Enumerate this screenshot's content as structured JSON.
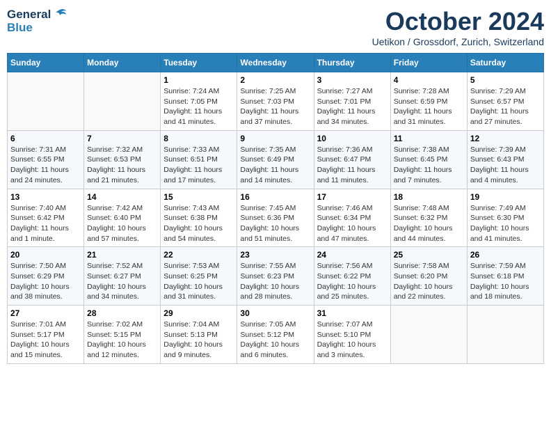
{
  "header": {
    "logo_general": "General",
    "logo_blue": "Blue",
    "month": "October 2024",
    "location": "Uetikon / Grossdorf, Zurich, Switzerland"
  },
  "weekdays": [
    "Sunday",
    "Monday",
    "Tuesday",
    "Wednesday",
    "Thursday",
    "Friday",
    "Saturday"
  ],
  "weeks": [
    [
      {
        "day": "",
        "info": ""
      },
      {
        "day": "",
        "info": ""
      },
      {
        "day": "1",
        "info": "Sunrise: 7:24 AM\nSunset: 7:05 PM\nDaylight: 11 hours and 41 minutes."
      },
      {
        "day": "2",
        "info": "Sunrise: 7:25 AM\nSunset: 7:03 PM\nDaylight: 11 hours and 37 minutes."
      },
      {
        "day": "3",
        "info": "Sunrise: 7:27 AM\nSunset: 7:01 PM\nDaylight: 11 hours and 34 minutes."
      },
      {
        "day": "4",
        "info": "Sunrise: 7:28 AM\nSunset: 6:59 PM\nDaylight: 11 hours and 31 minutes."
      },
      {
        "day": "5",
        "info": "Sunrise: 7:29 AM\nSunset: 6:57 PM\nDaylight: 11 hours and 27 minutes."
      }
    ],
    [
      {
        "day": "6",
        "info": "Sunrise: 7:31 AM\nSunset: 6:55 PM\nDaylight: 11 hours and 24 minutes."
      },
      {
        "day": "7",
        "info": "Sunrise: 7:32 AM\nSunset: 6:53 PM\nDaylight: 11 hours and 21 minutes."
      },
      {
        "day": "8",
        "info": "Sunrise: 7:33 AM\nSunset: 6:51 PM\nDaylight: 11 hours and 17 minutes."
      },
      {
        "day": "9",
        "info": "Sunrise: 7:35 AM\nSunset: 6:49 PM\nDaylight: 11 hours and 14 minutes."
      },
      {
        "day": "10",
        "info": "Sunrise: 7:36 AM\nSunset: 6:47 PM\nDaylight: 11 hours and 11 minutes."
      },
      {
        "day": "11",
        "info": "Sunrise: 7:38 AM\nSunset: 6:45 PM\nDaylight: 11 hours and 7 minutes."
      },
      {
        "day": "12",
        "info": "Sunrise: 7:39 AM\nSunset: 6:43 PM\nDaylight: 11 hours and 4 minutes."
      }
    ],
    [
      {
        "day": "13",
        "info": "Sunrise: 7:40 AM\nSunset: 6:42 PM\nDaylight: 11 hours and 1 minute."
      },
      {
        "day": "14",
        "info": "Sunrise: 7:42 AM\nSunset: 6:40 PM\nDaylight: 10 hours and 57 minutes."
      },
      {
        "day": "15",
        "info": "Sunrise: 7:43 AM\nSunset: 6:38 PM\nDaylight: 10 hours and 54 minutes."
      },
      {
        "day": "16",
        "info": "Sunrise: 7:45 AM\nSunset: 6:36 PM\nDaylight: 10 hours and 51 minutes."
      },
      {
        "day": "17",
        "info": "Sunrise: 7:46 AM\nSunset: 6:34 PM\nDaylight: 10 hours and 47 minutes."
      },
      {
        "day": "18",
        "info": "Sunrise: 7:48 AM\nSunset: 6:32 PM\nDaylight: 10 hours and 44 minutes."
      },
      {
        "day": "19",
        "info": "Sunrise: 7:49 AM\nSunset: 6:30 PM\nDaylight: 10 hours and 41 minutes."
      }
    ],
    [
      {
        "day": "20",
        "info": "Sunrise: 7:50 AM\nSunset: 6:29 PM\nDaylight: 10 hours and 38 minutes."
      },
      {
        "day": "21",
        "info": "Sunrise: 7:52 AM\nSunset: 6:27 PM\nDaylight: 10 hours and 34 minutes."
      },
      {
        "day": "22",
        "info": "Sunrise: 7:53 AM\nSunset: 6:25 PM\nDaylight: 10 hours and 31 minutes."
      },
      {
        "day": "23",
        "info": "Sunrise: 7:55 AM\nSunset: 6:23 PM\nDaylight: 10 hours and 28 minutes."
      },
      {
        "day": "24",
        "info": "Sunrise: 7:56 AM\nSunset: 6:22 PM\nDaylight: 10 hours and 25 minutes."
      },
      {
        "day": "25",
        "info": "Sunrise: 7:58 AM\nSunset: 6:20 PM\nDaylight: 10 hours and 22 minutes."
      },
      {
        "day": "26",
        "info": "Sunrise: 7:59 AM\nSunset: 6:18 PM\nDaylight: 10 hours and 18 minutes."
      }
    ],
    [
      {
        "day": "27",
        "info": "Sunrise: 7:01 AM\nSunset: 5:17 PM\nDaylight: 10 hours and 15 minutes."
      },
      {
        "day": "28",
        "info": "Sunrise: 7:02 AM\nSunset: 5:15 PM\nDaylight: 10 hours and 12 minutes."
      },
      {
        "day": "29",
        "info": "Sunrise: 7:04 AM\nSunset: 5:13 PM\nDaylight: 10 hours and 9 minutes."
      },
      {
        "day": "30",
        "info": "Sunrise: 7:05 AM\nSunset: 5:12 PM\nDaylight: 10 hours and 6 minutes."
      },
      {
        "day": "31",
        "info": "Sunrise: 7:07 AM\nSunset: 5:10 PM\nDaylight: 10 hours and 3 minutes."
      },
      {
        "day": "",
        "info": ""
      },
      {
        "day": "",
        "info": ""
      }
    ]
  ]
}
